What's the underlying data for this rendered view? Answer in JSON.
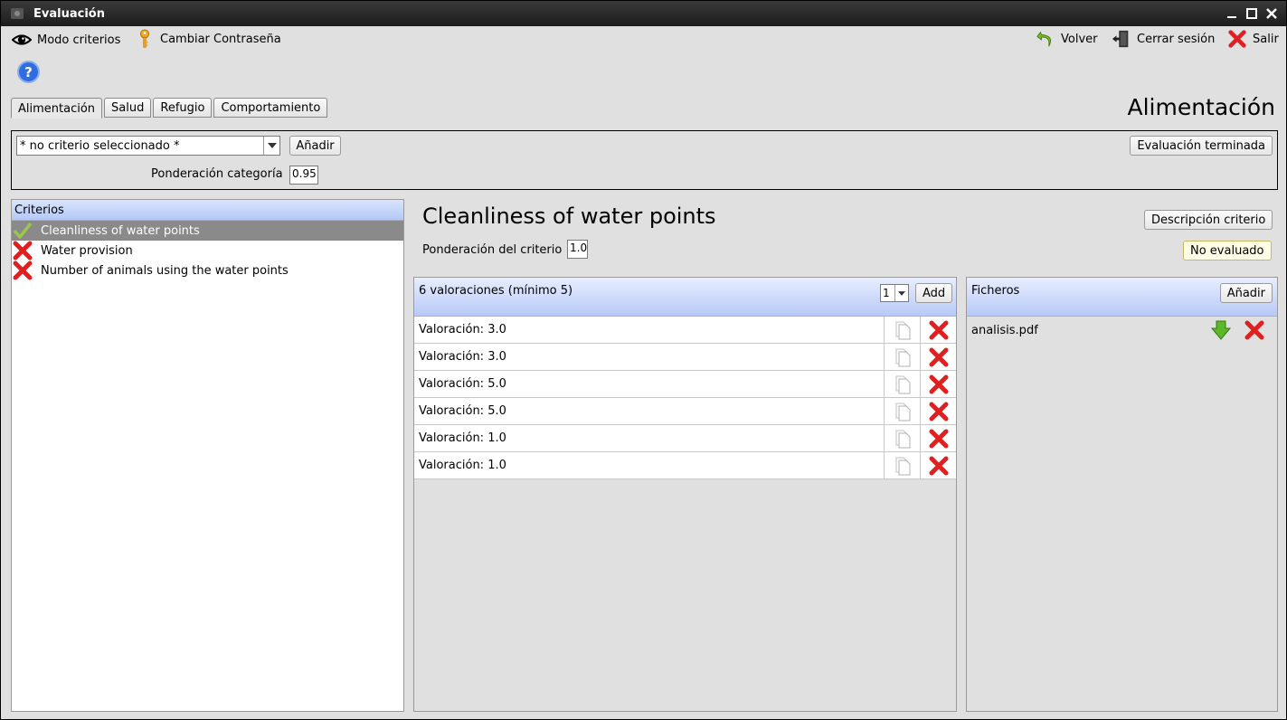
{
  "window": {
    "title": "Evaluación"
  },
  "toolbar": {
    "modo_criterios": "Modo criterios",
    "cambiar_contrasena": "Cambiar Contraseña",
    "volver": "Volver",
    "cerrar_sesion": "Cerrar sesión",
    "salir": "Salir"
  },
  "tabs": [
    {
      "label": "Alimentación",
      "active": true
    },
    {
      "label": "Salud",
      "active": false
    },
    {
      "label": "Refugio",
      "active": false
    },
    {
      "label": "Comportamiento",
      "active": false
    }
  ],
  "section_title": "Alimentación",
  "category": {
    "combo_value": "* no criterio seleccionado *",
    "add_label": "Añadir",
    "ponderacion_label": "Ponderación categoría",
    "ponderacion_value": "0.95",
    "finished_label": "Evaluación terminada"
  },
  "criteria": {
    "header": "Criterios",
    "items": [
      {
        "label": "Cleanliness of water points",
        "status": "check-icon",
        "selected": true
      },
      {
        "label": "Water provision",
        "status": "cross-icon",
        "selected": false
      },
      {
        "label": "Number of animals using the water points",
        "status": "cross-icon",
        "selected": false
      }
    ]
  },
  "detail": {
    "title": "Cleanliness of water points",
    "descripcion_label": "Descripción criterio",
    "ponderacion_label": "Ponderación del criterio",
    "ponderacion_value": "1.0",
    "status_label": "No evaluado"
  },
  "valoraciones": {
    "header": "6 valoraciones (mínimo 5)",
    "spinner_value": "1",
    "add_label": "Add",
    "rows": [
      {
        "text": "Valoración: 3.0"
      },
      {
        "text": "Valoración: 3.0"
      },
      {
        "text": "Valoración: 5.0"
      },
      {
        "text": "Valoración: 5.0"
      },
      {
        "text": "Valoración: 1.0"
      },
      {
        "text": "Valoración: 1.0"
      }
    ]
  },
  "ficheros": {
    "header": "Ficheros",
    "add_label": "Añadir",
    "files": [
      {
        "name": "analisis.pdf"
      }
    ]
  },
  "colors": {
    "header_blue": "#b7c9f7",
    "selected_row": "#8a8a8a",
    "delete_red": "#e02020",
    "download_green": "#4aaa20"
  }
}
